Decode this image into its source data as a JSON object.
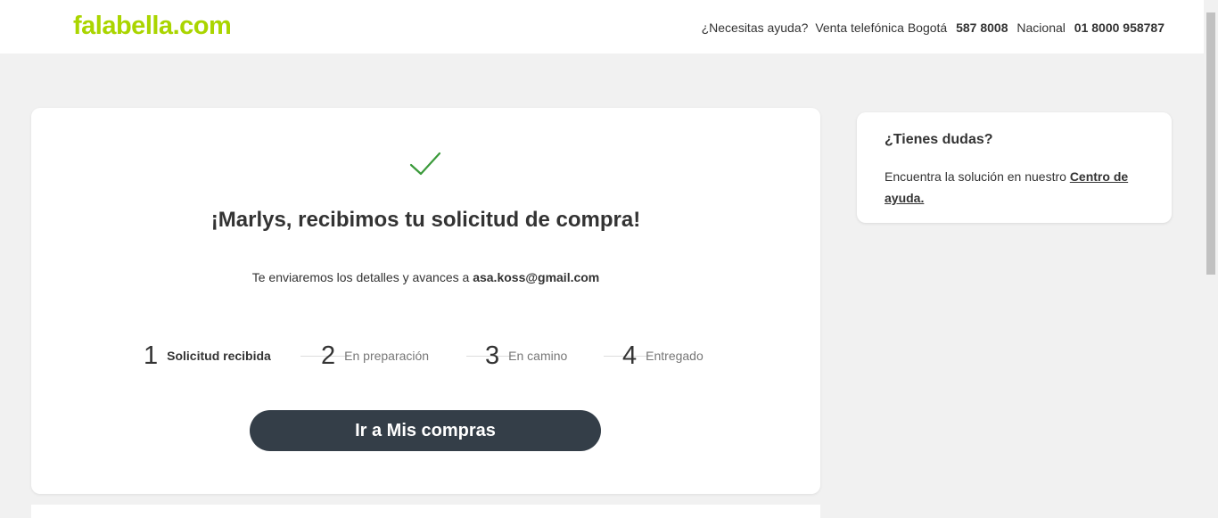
{
  "header": {
    "logo_text": "falabella",
    "logo_suffix": ".com",
    "help_question": "¿Necesitas ayuda?",
    "bogota_label": "Venta telefónica Bogotá",
    "bogota_phone": "587 8008",
    "national_label": "Nacional",
    "national_phone": "01 8000 958787"
  },
  "confirmation": {
    "title": "¡Marlys, recibimos tu solicitud de compra!",
    "subtitle_prefix": "Te enviaremos los detalles y avances a ",
    "email": "asa.koss@gmail.com",
    "steps": [
      {
        "num": "1",
        "label": "Solicitud recibida",
        "active": true
      },
      {
        "num": "2",
        "label": "En preparación",
        "active": false
      },
      {
        "num": "3",
        "label": "En camino",
        "active": false
      },
      {
        "num": "4",
        "label": "Entregado",
        "active": false
      }
    ],
    "cta_label": "Ir a Mis compras"
  },
  "sidebar": {
    "title": "¿Tienes dudas?",
    "text": "Encuentra la solución en nuestro",
    "link_label": "Centro de ayuda."
  },
  "colors": {
    "brand": "#aad500",
    "check": "#3a9a3a",
    "cta_bg": "#343e48"
  },
  "icons": {
    "check": "check-icon"
  }
}
